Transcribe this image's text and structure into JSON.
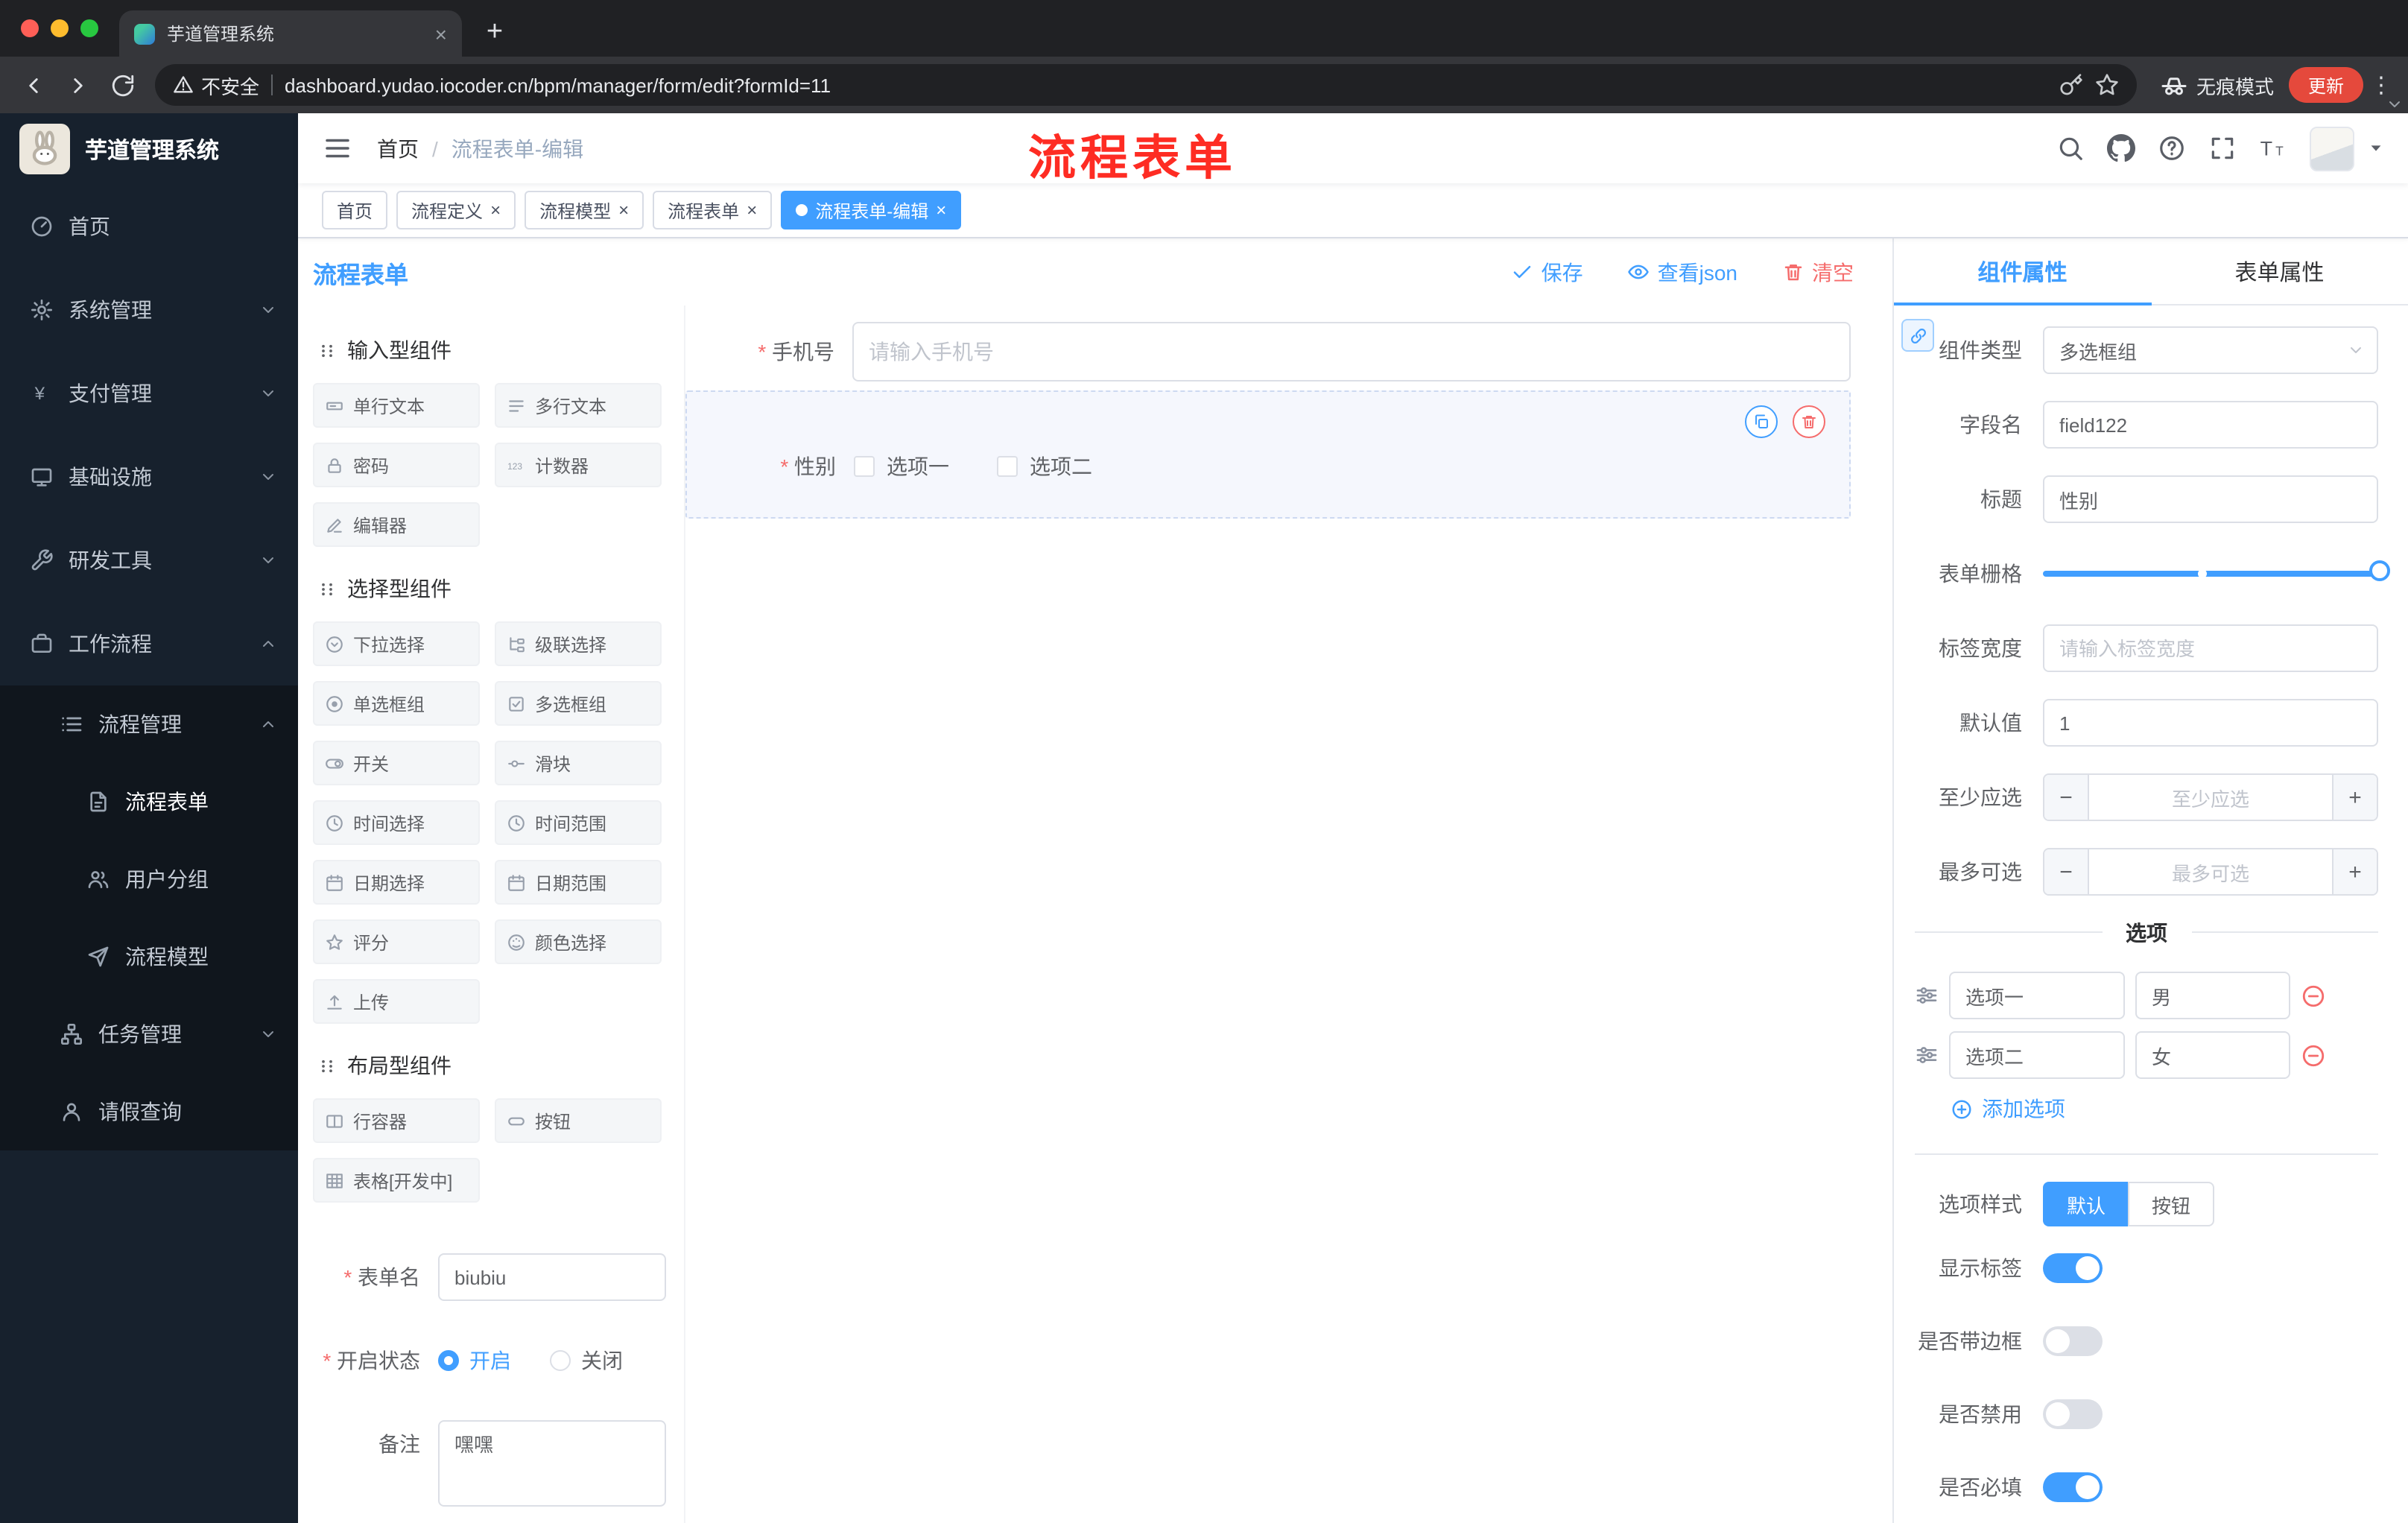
{
  "browser": {
    "tab": {
      "title": "芋道管理系统"
    },
    "address": {
      "security": "不安全",
      "url": "dashboard.yudao.iocoder.cn/bpm/manager/form/edit?formId=11"
    },
    "incognito_label": "无痕模式",
    "update_label": "更新"
  },
  "sidebar": {
    "logo": "芋道管理系统",
    "items": [
      {
        "label": "首页"
      },
      {
        "label": "系统管理"
      },
      {
        "label": "支付管理"
      },
      {
        "label": "基础设施"
      },
      {
        "label": "研发工具"
      },
      {
        "label": "工作流程"
      },
      {
        "label": "流程管理"
      },
      {
        "label": "流程表单"
      },
      {
        "label": "用户分组"
      },
      {
        "label": "流程模型"
      },
      {
        "label": "任务管理"
      },
      {
        "label": "请假查询"
      }
    ]
  },
  "navbar": {
    "breadcrumb": {
      "home": "首页",
      "current": "流程表单-编辑"
    },
    "annotation": "流程表单"
  },
  "tags": [
    {
      "label": "首页"
    },
    {
      "label": "流程定义"
    },
    {
      "label": "流程模型"
    },
    {
      "label": "流程表单"
    },
    {
      "label": "流程表单-编辑"
    }
  ],
  "designer": {
    "title": "流程表单",
    "actions": {
      "save": "保存",
      "view_json": "查看json",
      "clear": "清空"
    },
    "groups": [
      {
        "title": "输入型组件",
        "items": [
          {
            "label": "单行文本"
          },
          {
            "label": "多行文本"
          },
          {
            "label": "密码"
          },
          {
            "label": "计数器"
          },
          {
            "label": "编辑器"
          }
        ]
      },
      {
        "title": "选择型组件",
        "items": [
          {
            "label": "下拉选择"
          },
          {
            "label": "级联选择"
          },
          {
            "label": "单选框组"
          },
          {
            "label": "多选框组"
          },
          {
            "label": "开关"
          },
          {
            "label": "滑块"
          },
          {
            "label": "时间选择"
          },
          {
            "label": "时间范围"
          },
          {
            "label": "日期选择"
          },
          {
            "label": "日期范围"
          },
          {
            "label": "评分"
          },
          {
            "label": "颜色选择"
          },
          {
            "label": "上传"
          }
        ]
      },
      {
        "title": "布局型组件",
        "items": [
          {
            "label": "行容器"
          },
          {
            "label": "按钮"
          },
          {
            "label": "表格[开发中]"
          }
        ]
      }
    ],
    "meta": {
      "name_label": "表单名",
      "name_value": "biubiu",
      "status_label": "开启状态",
      "status_on": "开启",
      "status_off": "关闭",
      "status_value": "开启",
      "remark_label": "备注",
      "remark_value": "嘿嘿"
    },
    "canvas": {
      "phone": {
        "label": "手机号",
        "placeholder": "请输入手机号"
      },
      "gender": {
        "label": "性别",
        "option1": "选项一",
        "option2": "选项二"
      }
    }
  },
  "properties": {
    "tab_component": "组件属性",
    "tab_form": "表单属性",
    "component_type_label": "组件类型",
    "component_type_value": "多选框组",
    "field_name_label": "字段名",
    "field_name_value": "field122",
    "title_label": "标题",
    "title_value": "性别",
    "grid_label": "表单栅格",
    "label_width_label": "标签宽度",
    "label_width_placeholder": "请输入标签宽度",
    "default_label": "默认值",
    "default_value": "1",
    "min_label": "至少应选",
    "min_placeholder": "至少应选",
    "max_label": "最多可选",
    "max_placeholder": "最多可选",
    "options_title": "选项",
    "options": [
      {
        "label": "选项一",
        "value": "男"
      },
      {
        "label": "选项二",
        "value": "女"
      }
    ],
    "add_option": "添加选项",
    "option_style_label": "选项样式",
    "option_style_default": "默认",
    "option_style_button": "按钮",
    "toggle_show_label": "显示标签",
    "toggle_border": "是否带边框",
    "toggle_disabled": "是否禁用",
    "toggle_required": "是否必填",
    "toggle_states": {
      "show_label": true,
      "border": false,
      "disabled": false,
      "required": true
    }
  },
  "colors": {
    "primary": "#409EFF",
    "danger": "#F56C6C",
    "annotation_red": "#FE2C23",
    "sidebar_bg": "#17212D",
    "chrome_bg": "#35363A"
  },
  "icons": {
    "back-icon": "left-arrow",
    "forward-icon": "right-arrow",
    "reload-icon": "circular-arrow",
    "warning-icon": "triangle-exclamation",
    "key-icon": "key",
    "star-icon": "star-outline",
    "incognito-icon": "spy-hat-glasses",
    "more-vert-icon": "three-dots",
    "hamburger-icon": "three-lines",
    "search-icon": "magnifier",
    "github-icon": "octocat",
    "question-icon": "circle-question",
    "fullscreen-icon": "corner-brackets",
    "font-size-icon": "double-T",
    "save-check-icon": "check",
    "view-eye-icon": "eye",
    "clear-trash-icon": "trash",
    "copy-icon": "two-squares",
    "delete-icon": "trash",
    "link-icon": "chain",
    "drag-icon": "six-dots",
    "option-drag-icon": "sliders",
    "add-circle-icon": "circle-plus",
    "remove-circle-icon": "circle-minus"
  }
}
